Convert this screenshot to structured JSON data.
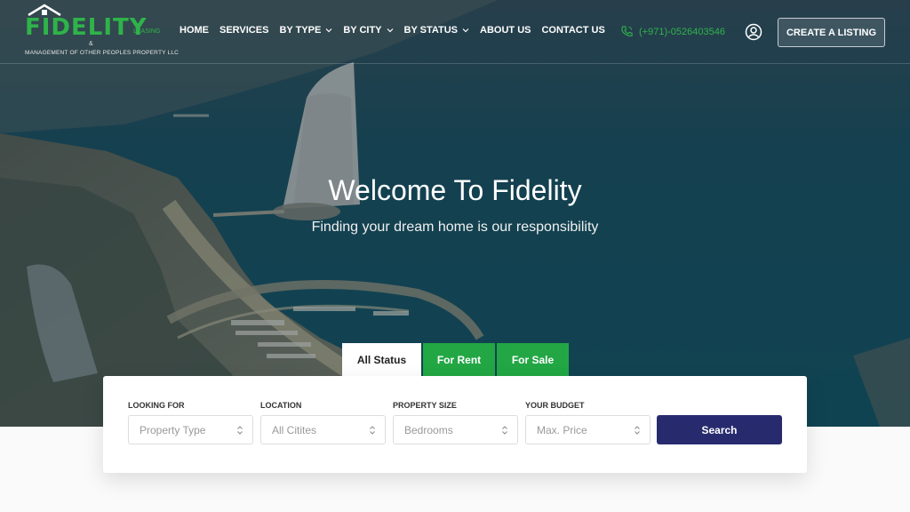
{
  "brand": {
    "logo_word": "FIDELITY",
    "logo_tag": "LEASING",
    "logo_amp": "&",
    "logo_sub": "MANAGEMENT OF OTHER PEOPLES PROPERTY LLC",
    "accent_color": "#2fb34a"
  },
  "nav": {
    "items": [
      {
        "label": "HOME",
        "dropdown": false
      },
      {
        "label": "SERVICES",
        "dropdown": false
      },
      {
        "label": "BY TYPE",
        "dropdown": true
      },
      {
        "label": "BY CITY",
        "dropdown": true
      },
      {
        "label": "BY STATUS",
        "dropdown": true
      },
      {
        "label": "ABOUT US",
        "dropdown": false
      },
      {
        "label": "CONTACT US",
        "dropdown": false
      }
    ],
    "phone": "(+971)-0526403546",
    "user_icon": "user-circle-icon",
    "create_listing": "CREATE A LISTING"
  },
  "hero": {
    "title": "Welcome To Fidelity",
    "subtitle": "Finding your dream home is our responsibility"
  },
  "search": {
    "tabs": [
      {
        "label": "All Status",
        "active": true
      },
      {
        "label": "For Rent",
        "active": false
      },
      {
        "label": "For Sale",
        "active": false
      }
    ],
    "fields": [
      {
        "label": "LOOKING FOR",
        "placeholder": "Property Type"
      },
      {
        "label": "LOCATION",
        "placeholder": "All Citites"
      },
      {
        "label": "PROPERTY SIZE",
        "placeholder": "Bedrooms"
      },
      {
        "label": "YOUR BUDGET",
        "placeholder": "Max. Price"
      }
    ],
    "button": "Search",
    "button_color": "#272b6e",
    "tab_color": "#22a744"
  }
}
